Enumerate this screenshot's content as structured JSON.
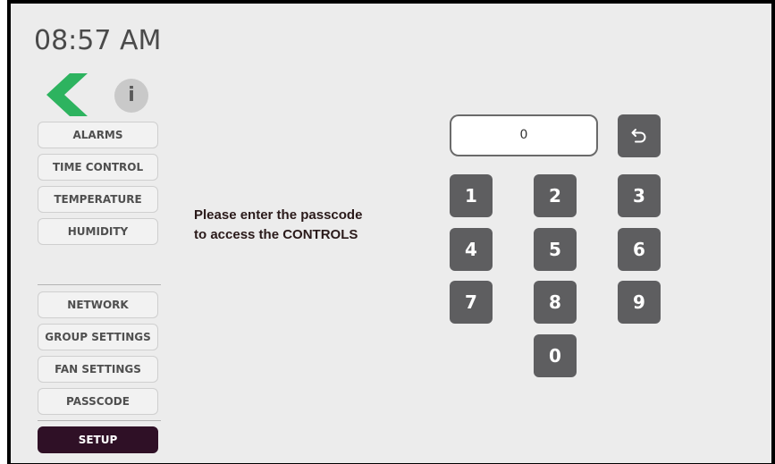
{
  "clock": {
    "time": "08:57 AM"
  },
  "icons": {
    "back": "chevron-left-icon",
    "info": "info-icon",
    "undo": "undo-icon"
  },
  "colors": {
    "back_arrow": "#2db35f",
    "key": "#5e5e60",
    "active_menu": "#2f1026"
  },
  "info_label": "i",
  "menu": {
    "top": [
      "ALARMS",
      "TIME CONTROL",
      "TEMPERATURE",
      "HUMIDITY"
    ],
    "bottom": [
      "NETWORK",
      "GROUP SETTINGS",
      "FAN SETTINGS",
      "PASSCODE"
    ],
    "active": "SETUP"
  },
  "prompt": {
    "line1": "Please enter the passcode",
    "line2": "to access the CONTROLS"
  },
  "passcode": {
    "value": "0"
  },
  "keypad": {
    "keys": [
      "1",
      "2",
      "3",
      "4",
      "5",
      "6",
      "7",
      "8",
      "9",
      "0"
    ]
  }
}
